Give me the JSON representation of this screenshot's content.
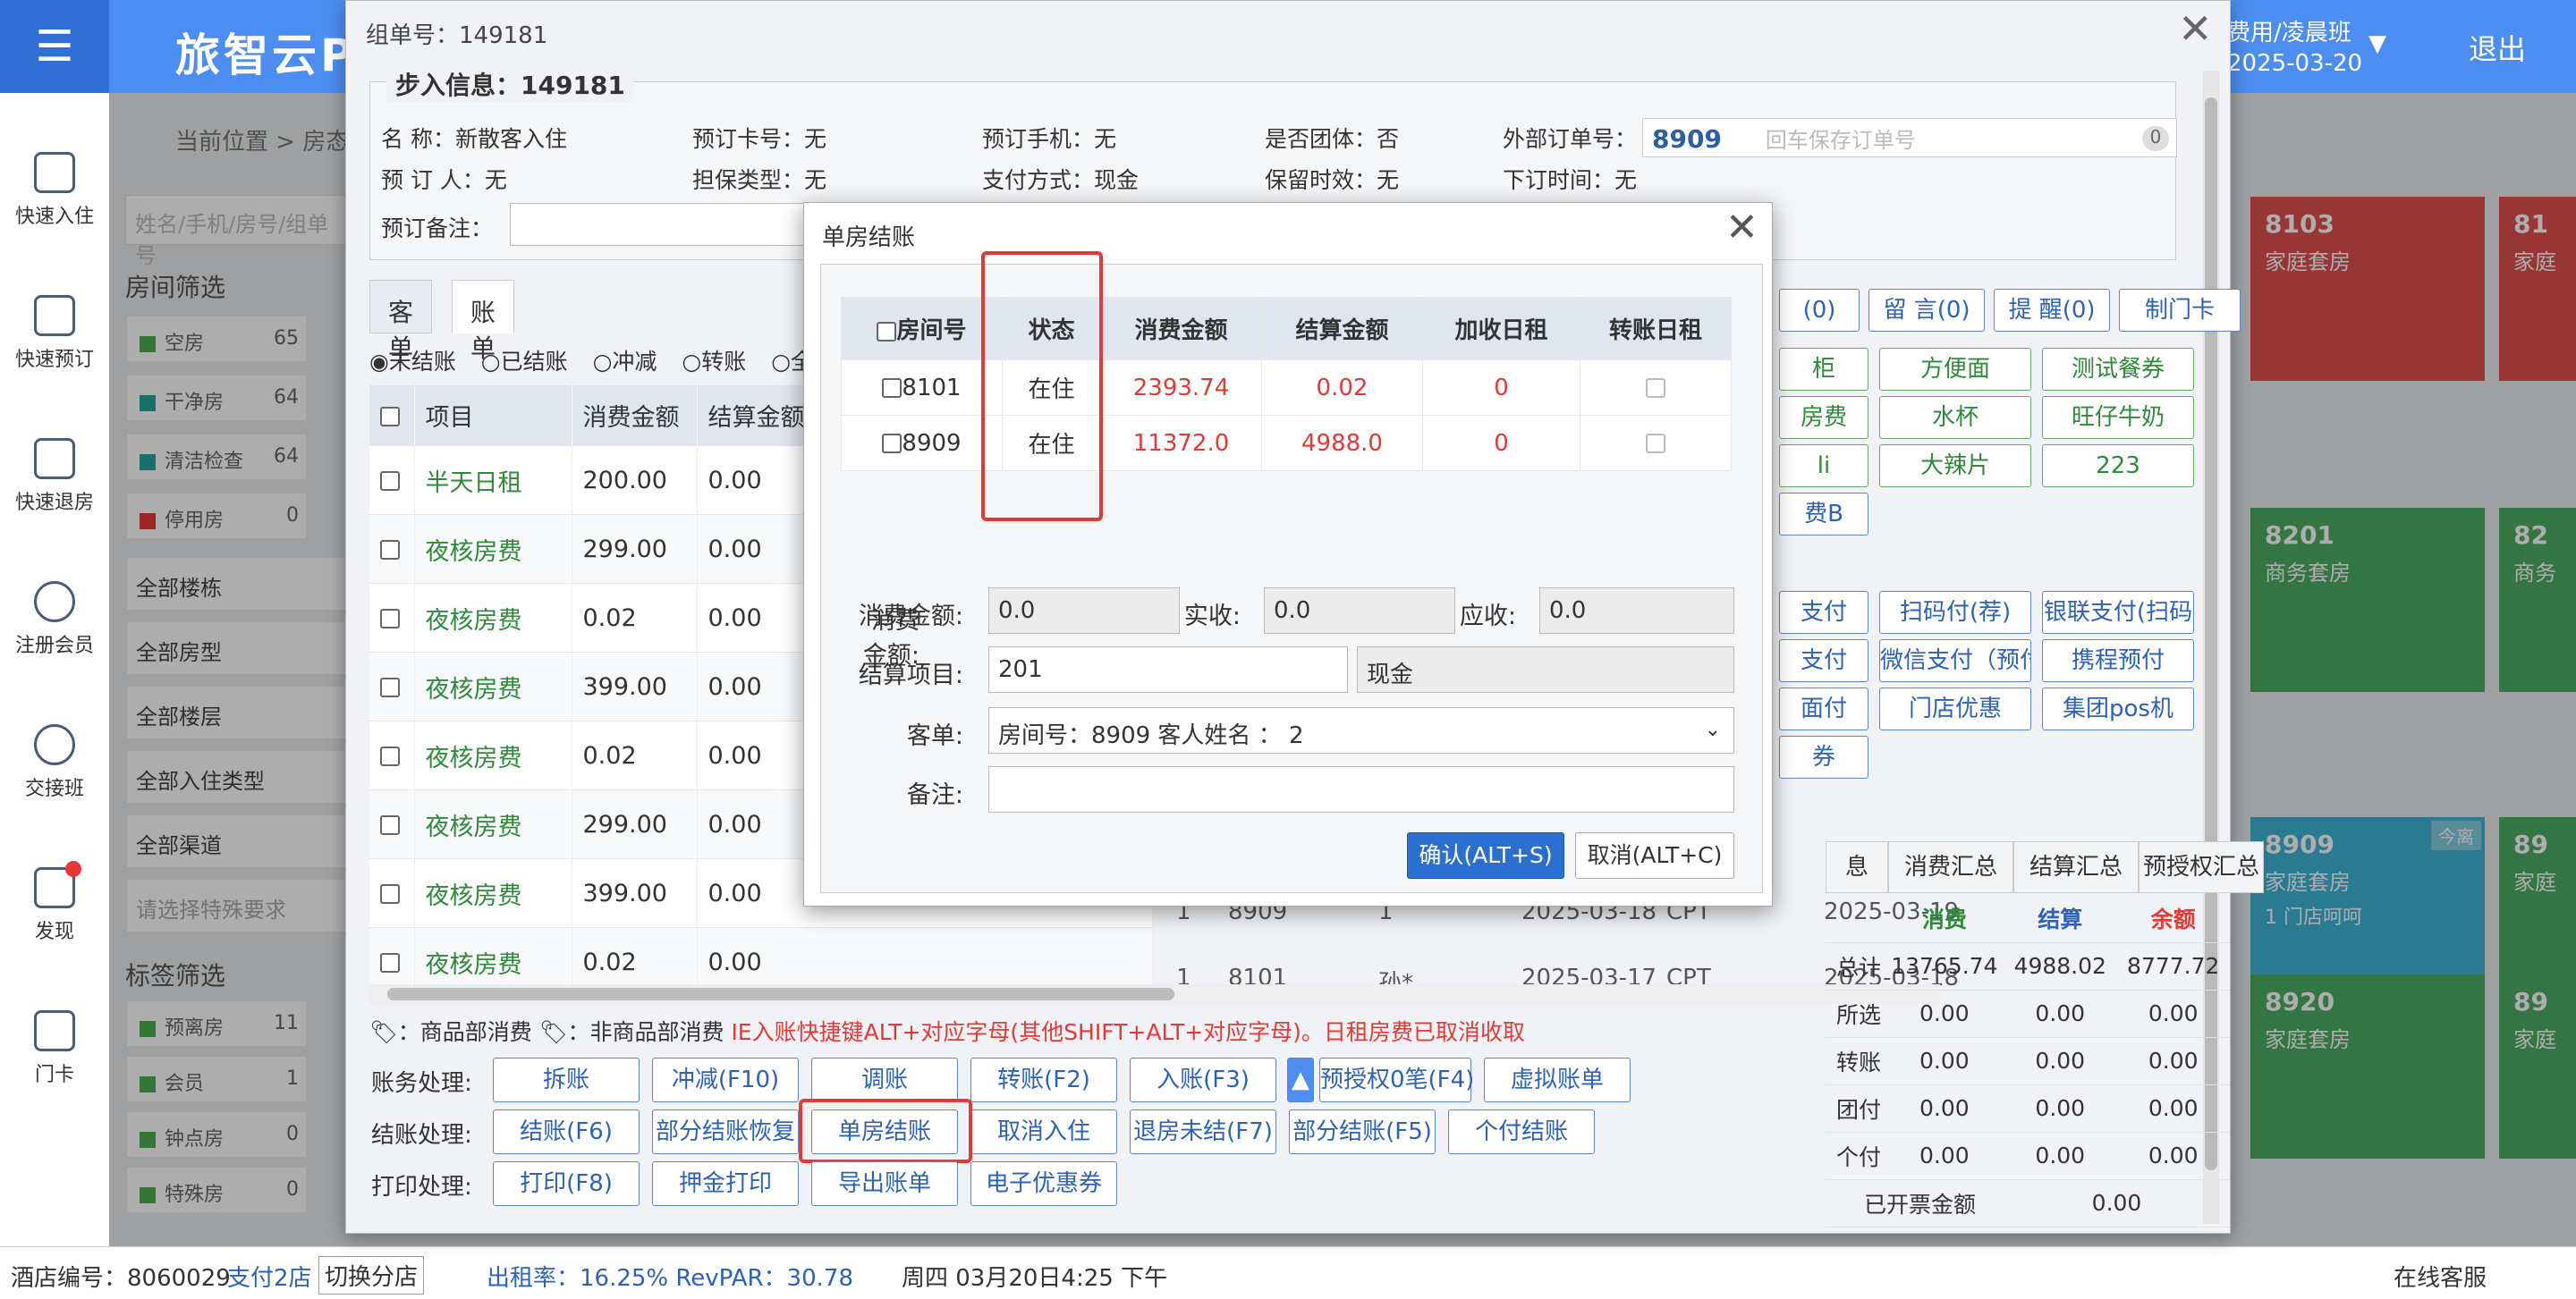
{
  "app": {
    "title": "旅智云P",
    "shift_line1": "费用/凌晨班",
    "shift_line2": "2025-03-20",
    "logout": "退出"
  },
  "sidebar": {
    "items": [
      {
        "label": "快速入住"
      },
      {
        "label": "快速预订"
      },
      {
        "label": "快速退房"
      },
      {
        "label": "注册会员"
      },
      {
        "label": "交接班"
      },
      {
        "label": "发现"
      },
      {
        "label": "门卡"
      }
    ]
  },
  "background": {
    "breadcrumb": "当前位置 > 房态",
    "search_placeholder": "姓名/手机/房号/组单号",
    "room_filter_title": "房间筛选",
    "room_filters": [
      {
        "label": "空房",
        "count": "65",
        "color": "#4caf50"
      },
      {
        "label": "干净房",
        "count": "64",
        "color": "#26a69a"
      },
      {
        "label": "清洁检查",
        "count": "64",
        "color": "#26a69a"
      },
      {
        "label": "停用房",
        "count": "0",
        "color": "#e53935"
      }
    ],
    "dropdowns": [
      "全部楼栋",
      "全部房型",
      "全部楼层",
      "全部入住类型",
      "全部渠道",
      "请选择特殊要求"
    ],
    "tag_filter_title": "标签筛选",
    "tag_filters": [
      {
        "icon": "离",
        "label": "预离房",
        "count": "11"
      },
      {
        "icon": "会",
        "label": "会员",
        "count": "1"
      },
      {
        "icon": "钟",
        "label": "钟点房",
        "count": "0"
      },
      {
        "icon": "特",
        "label": "特殊房",
        "count": "0"
      }
    ],
    "room_cards": [
      {
        "no": "8103",
        "type": "家庭套房",
        "color": "#e05050",
        "tag": "",
        "sub": ""
      },
      {
        "no": "8201",
        "type": "商务套房",
        "color": "#4caf63",
        "tag": "",
        "sub": ""
      },
      {
        "no": "8909",
        "type": "家庭套房",
        "color": "#3fb6d8",
        "tag": "今离",
        "sub": "1 门店呵呵"
      },
      {
        "no": "8920",
        "type": "家庭套房",
        "color": "#4caf63",
        "tag": "",
        "sub": ""
      }
    ],
    "room_cards_partial": [
      {
        "no": "81",
        "type": "家庭",
        "color": "#e05050"
      },
      {
        "no": "82",
        "type": "商务",
        "color": "#4caf63"
      },
      {
        "no": "89",
        "type": "家庭",
        "color": "#4caf63"
      },
      {
        "no": "89",
        "type": "家庭",
        "color": "#4caf63"
      }
    ]
  },
  "statusbar": {
    "hotel_no": "酒店编号：8060029",
    "branch": "支付2店",
    "switch": "切换分店",
    "occupancy": "出租率：16.25% RevPAR：30.78",
    "datetime": "周四 03月20日4:25 下午",
    "service": "在线客服"
  },
  "group_dialog": {
    "title": "组单号：149181",
    "checkin_title": "步入信息：149181",
    "fields": {
      "name_label": "名    称：",
      "name_value": "新散客入住",
      "card_label": "预订卡号：",
      "card_value": "无",
      "phone_label": "预订手机：",
      "phone_value": "无",
      "group_label": "是否团体：",
      "group_value": "否",
      "ext_label": "外部订单号：",
      "ext_value": "8909",
      "ext_placeholder": "回车保存订单号",
      "ext_badge": "0",
      "booker_label": "预 订 人：",
      "booker_value": "无",
      "guarantee_label": "担保类型：",
      "guarantee_value": "无",
      "pay_label": "支付方式：",
      "pay_value": "现金",
      "hold_label": "保留时效：",
      "hold_value": "无",
      "order_time_label": "下订时间：",
      "order_time_value": "无",
      "remark_label": "预订备注："
    },
    "tabs": [
      {
        "label": "客单",
        "active": false
      },
      {
        "label": "账单",
        "active": true
      }
    ],
    "radios": [
      "未结账",
      "已结账",
      "冲减",
      "转账",
      "全部账"
    ],
    "bill_headers": [
      "项目",
      "消费金额",
      "结算金额"
    ],
    "bill_rows": [
      {
        "item": "半天日租",
        "amount": "200.00",
        "settle": "0.00"
      },
      {
        "item": "夜核房费",
        "amount": "299.00",
        "settle": "0.00"
      },
      {
        "item": "夜核房费",
        "amount": "0.02",
        "settle": "0.00"
      },
      {
        "item": "夜核房费",
        "amount": "399.00",
        "settle": "0.00"
      },
      {
        "item": "夜核房费",
        "amount": "0.02",
        "settle": "0.00"
      },
      {
        "item": "夜核房费",
        "amount": "299.00",
        "settle": "0.00"
      },
      {
        "item": "夜核房费",
        "amount": "399.00",
        "settle": "0.00"
      },
      {
        "item": "夜核房费",
        "amount": "0.02",
        "settle": "0.00"
      }
    ],
    "bill_extra_rows": [
      {
        "c1": "1",
        "c2": "8909",
        "c3": "1",
        "c4": "2025-03-18",
        "c5": "CPT",
        "c6": "2025-03-19"
      },
      {
        "c1": "1",
        "c2": "8101",
        "c3": "孙*",
        "c4": "2025-03-17",
        "c5": "CPT",
        "c6": "2025-03-18"
      }
    ],
    "notice_prefix": "：商品部消费",
    "notice_mid": "：非商品部消费",
    "notice_red": "IE入账快捷键ALT+对应字母(其他SHIFT+ALT+对应字母)。日租房费已取消收取",
    "ops": {
      "account_label": "账务处理:",
      "checkout_label": "结账处理:",
      "print_label": "打印处理:",
      "account_buttons": [
        "拆账",
        "冲减(F10)",
        "调账",
        "转账(F2)",
        "入账(F3)",
        "预授权0笔(F4)",
        "虚拟账单"
      ],
      "checkout_buttons": [
        "结账(F6)",
        "部分结账恢复",
        "单房结账",
        "取消入住",
        "退房未结(F7)",
        "部分结账(F5)",
        "个付结账"
      ],
      "print_buttons": [
        "打印(F8)",
        "押金打印",
        "导出账单",
        "电子优惠券"
      ]
    },
    "right_buttons": {
      "row0": [
        "(0)",
        "留 言(0)",
        "提 醒(0)",
        "制门卡"
      ],
      "goods": [
        "柜",
        "方便面",
        "测试餐券",
        "房费",
        "水杯",
        "旺仔牛奶",
        "li",
        "大辣片",
        "223",
        "费B"
      ],
      "pay": [
        "支付",
        "扫码付(荐)",
        "银联支付(扫码",
        "支付",
        "微信支付（预付",
        "携程预付",
        "面付",
        "门店优惠",
        "集团pos机",
        "券"
      ]
    },
    "summary": {
      "tabs": [
        "息",
        "消费汇总",
        "结算汇总",
        "预授权汇总"
      ],
      "col_headers": [
        "消费",
        "结算",
        "余额"
      ],
      "rows": [
        {
          "label": "总计",
          "v1": "13765.74",
          "v2": "4988.02",
          "v3": "8777.72"
        },
        {
          "label": "所选",
          "v1": "0.00",
          "v2": "0.00",
          "v3": "0.00"
        },
        {
          "label": "转账",
          "v1": "0.00",
          "v2": "0.00",
          "v3": "0.00"
        },
        {
          "label": "团付",
          "v1": "0.00",
          "v2": "0.00",
          "v3": "0.00"
        },
        {
          "label": "个付",
          "v1": "0.00",
          "v2": "0.00",
          "v3": "0.00"
        }
      ],
      "invoiced_label": "已开票金额",
      "invoiced_value": "0.00"
    }
  },
  "single_room_dialog": {
    "title": "单房结账",
    "headers": [
      "房间号",
      "状态",
      "消费金额",
      "结算金额",
      "加收日租",
      "转账日租"
    ],
    "rows": [
      {
        "room": "8101",
        "status": "在住",
        "amount": "2393.74",
        "settle": "0.02",
        "extra": "0"
      },
      {
        "room": "8909",
        "status": "在住",
        "amount": "11372.0",
        "settle": "4988.0",
        "extra": "0"
      }
    ],
    "form": {
      "consume_label": "消费金额:",
      "consume_value": "0.0",
      "received_label": "实收:",
      "received_value": "0.0",
      "due_label": "应收:",
      "due_value": "0.0",
      "item_label": "结算项目:",
      "item_code": "201",
      "item_name": "现金",
      "bill_label": "客单:",
      "bill_value": "房间号：8909 客人姓名 ： 2",
      "remark_label": "备注:",
      "remark_value": ""
    },
    "ok": "确认(ALT+S)",
    "cancel": "取消(ALT+C)"
  }
}
